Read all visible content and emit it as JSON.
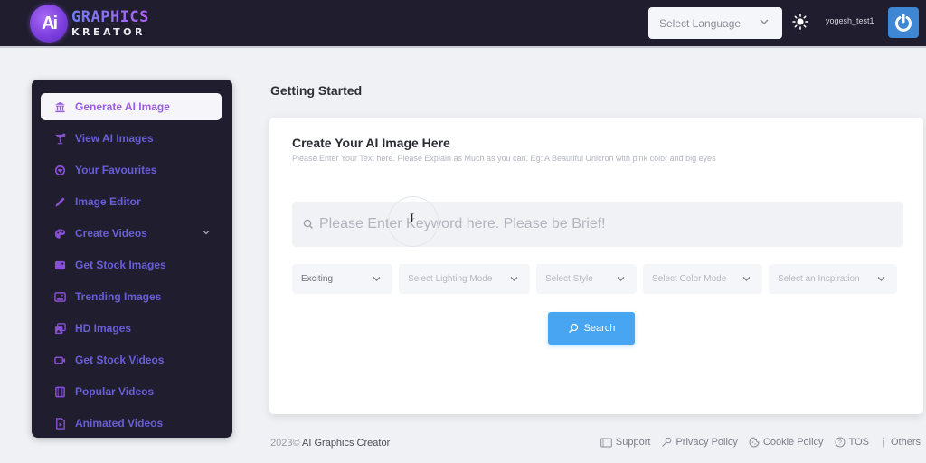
{
  "header": {
    "logo_badge": "Ai",
    "logo_line1": "GRAPHICS",
    "logo_line2": "KREATOR",
    "language_select": {
      "placeholder": "Select Language"
    },
    "theme_icon": "sun-icon",
    "username": "yogesh_test1",
    "power_icon": "power-icon"
  },
  "sidebar": {
    "items": [
      {
        "label": "Generate AI Image",
        "icon": "bank-icon",
        "active": true
      },
      {
        "label": "View AI Images",
        "icon": "cocktail-icon"
      },
      {
        "label": "Your Favourites",
        "icon": "smile-heart-icon"
      },
      {
        "label": "Image Editor",
        "icon": "pen-icon"
      },
      {
        "label": "Create Videos",
        "icon": "palette-icon",
        "expandable": true
      },
      {
        "label": "Get Stock Images",
        "icon": "stock-image-icon"
      },
      {
        "label": "Trending Images",
        "icon": "picture-icon"
      },
      {
        "label": "HD Images",
        "icon": "images-stack-icon"
      },
      {
        "label": "Get Stock Videos",
        "icon": "video-camera-icon"
      },
      {
        "label": "Popular Videos",
        "icon": "film-icon"
      },
      {
        "label": "Animated Videos",
        "icon": "file-play-icon"
      }
    ]
  },
  "main": {
    "page_title": "Getting Started",
    "card": {
      "title": "Create Your AI Image Here",
      "subtitle": "Please Enter Your Text here. Please Explain as Much as you can. Eg: A Beautiful Unicron with pink color and big eyes",
      "keyword_input": {
        "value": "",
        "placeholder": "Please Enter Keyword here. Please be Brief!"
      },
      "dropdowns": [
        {
          "value": "Exciting",
          "filled": true
        },
        {
          "value": "Select Lighting Mode"
        },
        {
          "value": "Select Style"
        },
        {
          "value": "Select Color Mode"
        },
        {
          "value": "Select an Inspiration"
        }
      ],
      "search_button": "Search"
    }
  },
  "footer": {
    "year": "2023©",
    "brand": "AI Graphics Creator",
    "links": [
      {
        "label": "Support",
        "icon": "ticket-icon"
      },
      {
        "label": "Privacy Policy",
        "icon": "key-icon"
      },
      {
        "label": "Cookie Policy",
        "icon": "cookie-icon"
      },
      {
        "label": "TOS",
        "icon": "question-circle-icon"
      },
      {
        "label": "Others",
        "icon": "info-icon"
      }
    ]
  },
  "colors": {
    "topbar_bg": "#1f1d2e",
    "sidebar_bg": "#1f1d2e",
    "sidebar_text": "#6a5ed6",
    "sidebar_active_text": "#9a5ce0",
    "accent_button": "#47a5f2",
    "power_button": "#3d87d4",
    "page_bg": "#eff1f5"
  }
}
